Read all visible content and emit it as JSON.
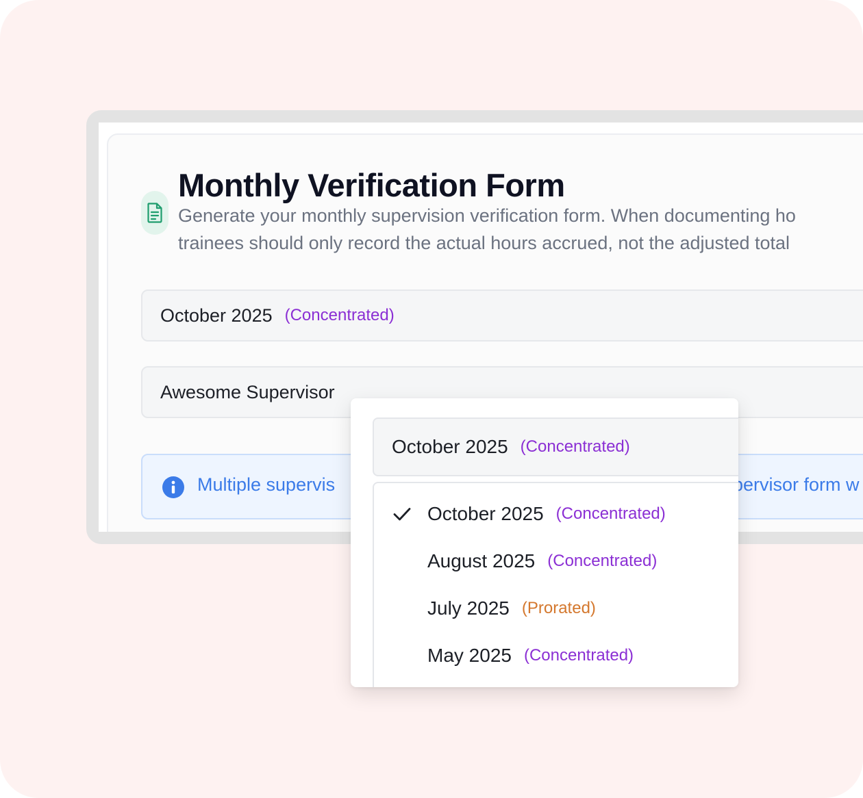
{
  "form": {
    "title": "Monthly Verification Form",
    "description_line1": "Generate your monthly supervision verification form. When documenting ho",
    "description_line2": "trainees should only record the actual hours accrued, not the adjusted total"
  },
  "month_select": {
    "value": "October 2025",
    "tag": "(Concentrated)"
  },
  "supervisor_select": {
    "value": "Awesome Supervisor"
  },
  "info_banner": {
    "text_left": "Multiple supervis",
    "text_right": "pervisor form w"
  },
  "dropdown": {
    "trigger": {
      "value": "October 2025",
      "tag": "(Concentrated)"
    },
    "options": [
      {
        "label": "October 2025",
        "tag": "(Concentrated)",
        "selected": true
      },
      {
        "label": "August 2025",
        "tag": "(Concentrated)",
        "selected": false
      },
      {
        "label": "July 2025",
        "tag": "(Prorated)",
        "selected": false
      },
      {
        "label": "May 2025",
        "tag": "(Concentrated)",
        "selected": false
      }
    ]
  },
  "colors": {
    "concentrated": "#8b2fd4",
    "prorated": "#d4782e",
    "info": "#3b7be8",
    "icon_green": "#1f9d6e"
  },
  "icons": {
    "form_icon": "document-icon",
    "info_icon": "info-circle-icon",
    "selected_icon": "check-icon"
  }
}
